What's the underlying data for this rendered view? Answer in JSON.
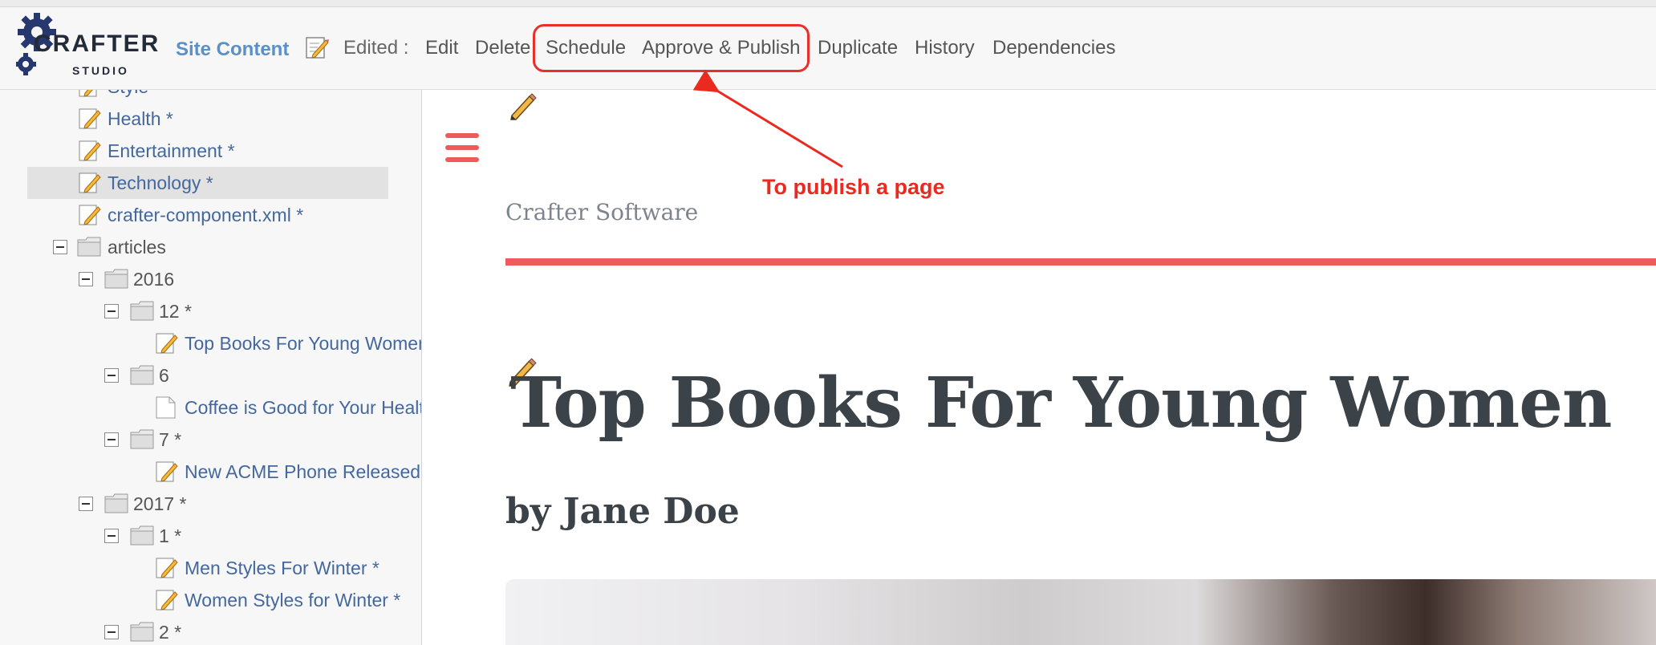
{
  "app": {
    "logo_text": "CRAFTER",
    "logo_sub": "STUDIO"
  },
  "toolbar": {
    "site_content": "Site Content",
    "edited_label": "Edited :",
    "actions": {
      "edit": "Edit",
      "delete": "Delete",
      "schedule": "Schedule",
      "approve_publish": "Approve & Publish",
      "duplicate": "Duplicate",
      "history": "History",
      "dependencies": "Dependencies"
    }
  },
  "sidebar": {
    "items": [
      {
        "label": "Style",
        "type": "page"
      },
      {
        "label": "Health *",
        "type": "page"
      },
      {
        "label": "Entertainment *",
        "type": "page"
      },
      {
        "label": "Technology *",
        "type": "page",
        "selected": true
      },
      {
        "label": "crafter-component.xml *",
        "type": "page"
      },
      {
        "label": "articles",
        "type": "folder"
      },
      {
        "label": "2016",
        "type": "folder"
      },
      {
        "label": "12 *",
        "type": "folder"
      },
      {
        "label": "Top Books For Young Women *",
        "type": "page"
      },
      {
        "label": "6",
        "type": "folder"
      },
      {
        "label": "Coffee is Good for Your Health",
        "type": "doc"
      },
      {
        "label": "7 *",
        "type": "folder"
      },
      {
        "label": "New ACME Phone Released Today *",
        "type": "page"
      },
      {
        "label": "2017 *",
        "type": "folder"
      },
      {
        "label": "1 *",
        "type": "folder"
      },
      {
        "label": "Men Styles For Winter *",
        "type": "page"
      },
      {
        "label": "Women Styles for Winter *",
        "type": "page"
      },
      {
        "label": "2 *",
        "type": "folder"
      }
    ]
  },
  "preview": {
    "brand": "Crafter Software",
    "headline": "Top Books For Young Women",
    "byline": "by Jane Doe"
  },
  "annotation": {
    "text": "To publish a page"
  },
  "colors": {
    "accent_red": "#ee5b5b",
    "annotation_red": "#ea2a20",
    "link_blue": "#44689d",
    "site_content_blue": "#5b8fc8"
  }
}
